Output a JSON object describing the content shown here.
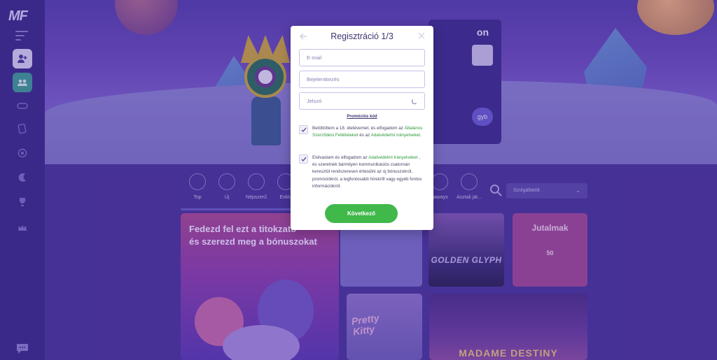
{
  "brand": {
    "logo_text": "MF"
  },
  "hero": {
    "panel_title": "on",
    "panel_button": "gyb"
  },
  "categories": [
    {
      "label": "Top"
    },
    {
      "label": "Új"
    },
    {
      "label": "Népszerű"
    },
    {
      "label": "Exklu"
    },
    {
      "label": "gaways"
    },
    {
      "label": "Asztali ját..."
    }
  ],
  "sort": {
    "label": "Szolgáltatók"
  },
  "tiles": {
    "promo_line1": "Fedezd fel ezt a titokzato",
    "promo_line2": "és szerezd meg a bónuszokat",
    "golden_glyph": "GOLDEN GLYPH",
    "rewards_title": "Jutalmak",
    "rewards_value": "50",
    "pretty_kitty_1": "Pretty",
    "pretty_kitty_2": "Kitty",
    "madame": "MADAME DESTINY"
  },
  "modal": {
    "title": "Regisztráció 1/3",
    "email_placeholder": "E-mail",
    "login_placeholder": "Bejelentkezés",
    "password_placeholder": "Jelszó",
    "promo_code_link": "Promóciós kód",
    "consent1": {
      "text_before": "Betöltöttem a 18. életévemet, és elfogadom az ",
      "link1": "Általános Szerződési Feltételeket",
      "text_mid": " és az ",
      "link2": "Adatvédelmi Irányelveket",
      "text_after": "."
    },
    "consent2": {
      "text_before": "Elolvastam és elfogadom az ",
      "link1": "Adatvédelmi Irányelveket",
      "text_after": " , és szeretnék bármilyen kommunikációs csatornán keresztül rendszeresen értesülni az új bónuszokról, promóciókról, a legfontosabb hírekről vagy egyéb fontos információkról."
    },
    "submit_label": "Következő"
  },
  "colors": {
    "accent_green": "#40b84a",
    "link_green": "#2f9a3c",
    "title_purple": "#413372"
  }
}
